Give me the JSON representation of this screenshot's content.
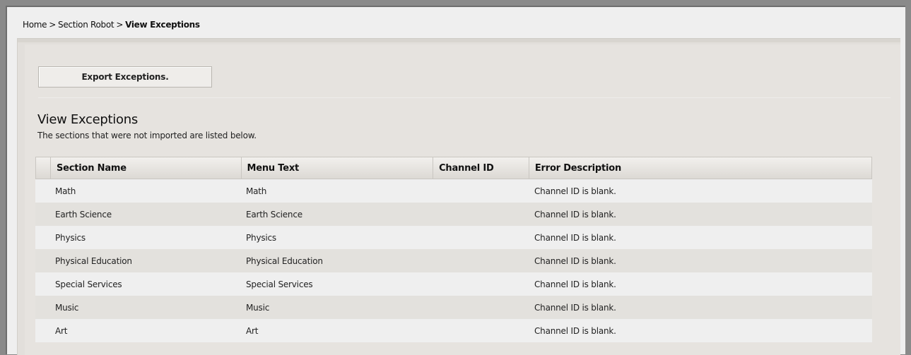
{
  "breadcrumb": {
    "home": "Home",
    "separator": ">",
    "section_robot": "Section Robot",
    "current": "View Exceptions"
  },
  "toolbar": {
    "export_label": "Export Exceptions."
  },
  "main": {
    "title": "View Exceptions",
    "description": "The sections that were not imported are listed below."
  },
  "table": {
    "columns": [
      "Section Name",
      "Menu Text",
      "Channel ID",
      "Error Description"
    ],
    "rows": [
      {
        "section_name": "Math",
        "menu_text": "Math",
        "channel_id": "",
        "error": "Channel ID is blank."
      },
      {
        "section_name": "Earth Science",
        "menu_text": "Earth Science",
        "channel_id": "",
        "error": "Channel ID is blank."
      },
      {
        "section_name": "Physics",
        "menu_text": "Physics",
        "channel_id": "",
        "error": "Channel ID is blank."
      },
      {
        "section_name": "Physical Education",
        "menu_text": "Physical Education",
        "channel_id": "",
        "error": "Channel ID is blank."
      },
      {
        "section_name": "Special Services",
        "menu_text": "Special Services",
        "channel_id": "",
        "error": "Channel ID is blank."
      },
      {
        "section_name": "Music",
        "menu_text": "Music",
        "channel_id": "",
        "error": "Channel ID is blank."
      },
      {
        "section_name": "Art",
        "menu_text": "Art",
        "channel_id": "",
        "error": "Channel ID is blank."
      }
    ]
  }
}
